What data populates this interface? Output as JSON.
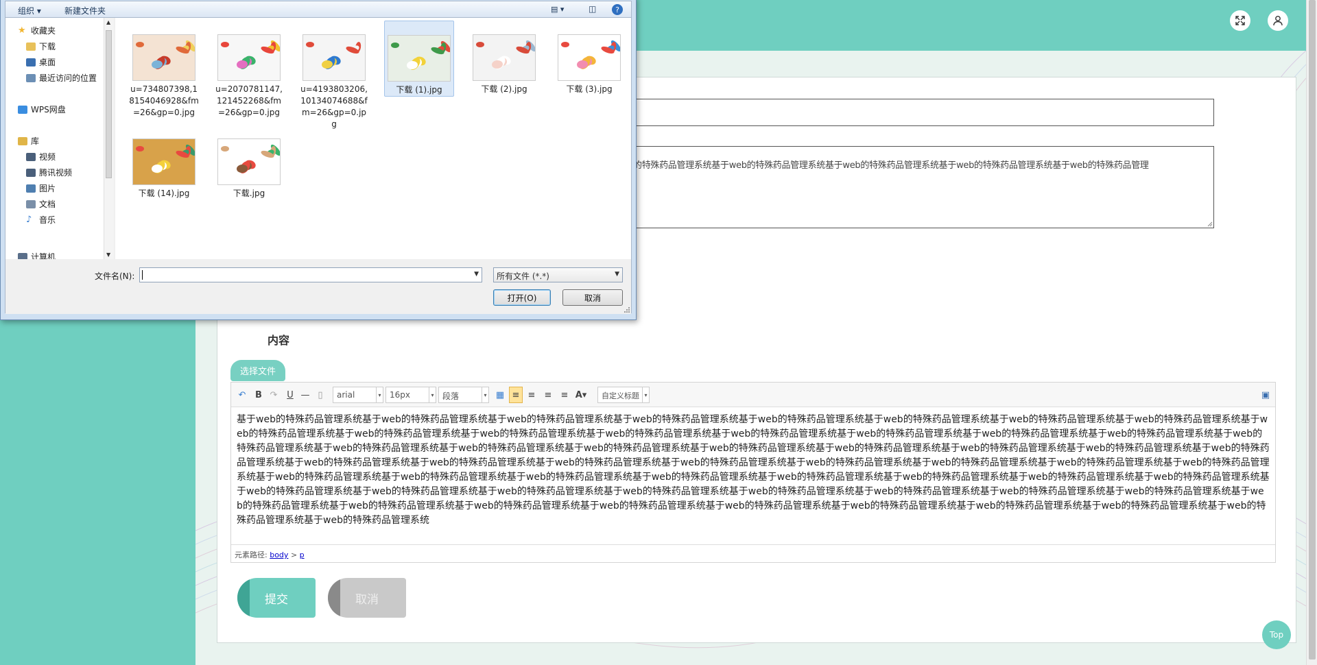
{
  "dialog": {
    "toolbar": {
      "organize": "组织 ▾",
      "new_folder": "新建文件夹"
    },
    "nav": [
      {
        "label": "收藏夹",
        "icon": "star-icon",
        "color": "#f2b632"
      },
      {
        "label": "下载",
        "icon": "download-folder-icon",
        "color": "#e8c15a"
      },
      {
        "label": "桌面",
        "icon": "desktop-icon",
        "color": "#3a6fb0"
      },
      {
        "label": "最近访问的位置",
        "icon": "recent-places-icon",
        "color": "#6c8fb5"
      },
      {
        "label": "WPS网盘",
        "icon": "cloud-drive-icon",
        "color": "#3a8de0"
      },
      {
        "label": "库",
        "icon": "library-icon",
        "color": "#e0b548"
      },
      {
        "label": "视频",
        "icon": "video-icon",
        "color": "#4a5f7a"
      },
      {
        "label": "腾讯视频",
        "icon": "tencent-video-icon",
        "color": "#4a5f7a"
      },
      {
        "label": "图片",
        "icon": "pictures-icon",
        "color": "#4f7fb0"
      },
      {
        "label": "文档",
        "icon": "documents-icon",
        "color": "#7a8fa8"
      },
      {
        "label": "音乐",
        "icon": "music-icon",
        "color": "#3a7fd0"
      },
      {
        "label": "计算机",
        "icon": "computer-icon",
        "color": "#5a6f8a"
      }
    ],
    "files": [
      {
        "name": "u=734807398,18154046928&fm=26&gp=0.jpg",
        "lines": [
          "u=734807398,1",
          "8154046928&fm",
          "=26&gp=0.jpg"
        ]
      },
      {
        "name": "u=2070781147,121452268&fm=26&gp=0.jpg",
        "lines": [
          "u=2070781147,",
          "121452268&fm",
          "=26&gp=0.jpg"
        ]
      },
      {
        "name": "u=4193803206,10134074688&fm=26&gp=0.jpg",
        "lines": [
          "u=4193803206,",
          "10134074688&f",
          "m=26&gp=0.jp",
          "g"
        ]
      },
      {
        "name": "下载 (1).jpg",
        "lines": [
          "下载 (1).jpg"
        ]
      },
      {
        "name": "下载 (2).jpg",
        "lines": [
          "下载 (2).jpg"
        ]
      },
      {
        "name": "下载 (3).jpg",
        "lines": [
          "下载 (3).jpg"
        ]
      },
      {
        "name": "下载 (14).jpg",
        "lines": [
          "下载 (14).jpg"
        ]
      },
      {
        "name": "下载.jpg",
        "lines": [
          "下载.jpg"
        ]
      }
    ],
    "filename_label": "文件名(N):",
    "filename_value": "",
    "filetype": "所有文件 (*.*)",
    "open_label": "打开(O)",
    "cancel_label": "取消"
  },
  "form": {
    "textarea_text": "的特殊药品管理系统基于web的特殊药品管理系统基于web的特殊药品管理系统基于web的特殊药品管理系统基于web的特殊药品管理",
    "content_label": "内容",
    "choose_file": "选择文件",
    "editor": {
      "font": "arial",
      "size": "16px",
      "paragraph": "段落",
      "custom_title": "自定义标题",
      "body": "基于web的特殊药品管理系统基于web的特殊药品管理系统基于web的特殊药品管理系统基于web的特殊药品管理系统基于web的特殊药品管理系统基于web的特殊药品管理系统基于web的特殊药品管理系统基于web的特殊药品管理系统基于web的特殊药品管理系统基于web的特殊药品管理系统基于web的特殊药品管理系统基于web的特殊药品管理系统基于web的特殊药品管理系统基于web的特殊药品管理系统基于web的特殊药品管理系统基于web的特殊药品管理系统基于web的特殊药品管理系统基于web的特殊药品管理系统基于web的特殊药品管理系统基于web的特殊药品管理系统基于web的特殊药品管理系统基于web的特殊药品管理系统基于web的特殊药品管理系统基于web的特殊药品管理系统基于web的特殊药品管理系统基于web的特殊药品管理系统基于web的特殊药品管理系统基于web的特殊药品管理系统基于web的特殊药品管理系统基于web的特殊药品管理系统基于web的特殊药品管理系统基于web的特殊药品管理系统基于web的特殊药品管理系统基于web的特殊药品管理系统基于web的特殊药品管理系统基于web的特殊药品管理系统基于web的特殊药品管理系统基于web的特殊药品管理系统基于web的特殊药品管理系统基于web的特殊药品管理系统基于web的特殊药品管理系统基于web的特殊药品管理系统基于web的特殊药品管理系统基于web的特殊药品管理系统基于web的特殊药品管理系统基于web的特殊药品管理系统基于web的特殊药品管理系统基于web的特殊药品管理系统基于web的特殊药品管理系统基于web的特殊药品管理系统基于web的特殊药品管理系统基于web的特殊药品管理系统基于web的特殊药品管理系统基于web的特殊药品管理系统基于web的特殊药品管理系统基于web的特殊药品管理系统基于web的特殊药品管理系统基于web的特殊药品管理系统基于web的特殊药品管理系统",
      "path_label": "元素路径:",
      "path_body": "body",
      "path_sep": ">",
      "path_p": "p"
    },
    "submit": "提交",
    "cancel": "取消"
  },
  "top_button": "Top",
  "colors": {
    "accent": "#6fcfc0",
    "submit": "#6fcfc0",
    "cancel": "#c9c9c9"
  }
}
